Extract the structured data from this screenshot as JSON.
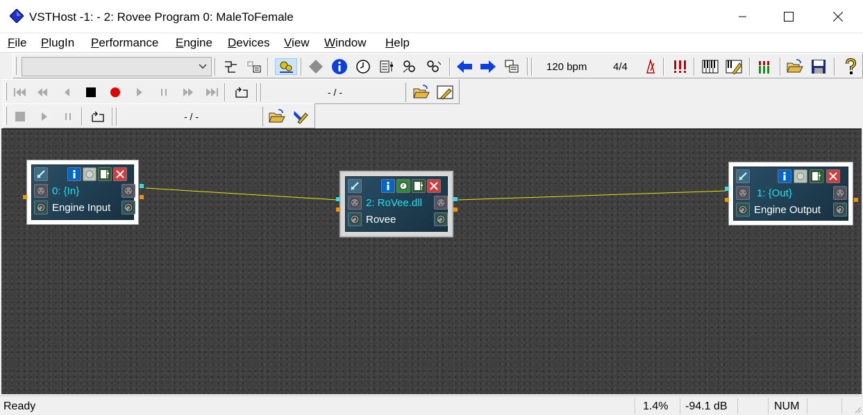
{
  "window": {
    "title": "VSTHost -1:  - 2: Rovee Program 0: MaleToFemale",
    "controls": [
      "minimize-icon",
      "maximize-icon",
      "close-icon"
    ]
  },
  "menu": {
    "items": [
      {
        "label_ul": "F",
        "label_rest": "ile"
      },
      {
        "label_ul": "P",
        "label_rest": "lugIn"
      },
      {
        "label_ul": "P",
        "label_rest": "erformance"
      },
      {
        "label_ul": "E",
        "label_rest": "ngine"
      },
      {
        "label_ul": "D",
        "label_rest": "evices"
      },
      {
        "label_ul": "V",
        "label_rest": "iew"
      },
      {
        "label_ul": "W",
        "label_rest": "indow"
      },
      {
        "label_ul": "H",
        "label_rest": "elp"
      }
    ]
  },
  "toolbar": {
    "plugin_combo_value": "",
    "bpm": "120 bpm",
    "time_signature": "4/4",
    "icons_row1": [
      "chain-plugin-icon",
      "chain-list-icon",
      "engine-bypass-icon",
      "diamond-icon",
      "info-icon",
      "clock-icon",
      "parameters-icon",
      "midi-link-icon",
      "midi-link-2-icon",
      "arrow-left-icon",
      "arrow-right-icon",
      "windows-icon",
      "metronome-icon",
      "alert-icon",
      "keyboard-icon",
      "keyboard-config-icon",
      "vu-meter-icon",
      "open-folder-icon",
      "save-icon",
      "help-icon"
    ]
  },
  "player": {
    "position": "- / -",
    "icons": [
      "to-start-icon",
      "rewind-icon",
      "back-icon",
      "stop-icon",
      "record-icon",
      "play-icon",
      "pause-icon",
      "forward-icon",
      "to-end-icon",
      "loop-icon",
      "open-folder-icon",
      "configure-icon"
    ]
  },
  "recorder": {
    "position": "- / -",
    "icons": [
      "stop-icon",
      "play-icon",
      "pause-icon",
      "loop-icon",
      "open-folder-icon",
      "configure-icon"
    ]
  },
  "nodes": [
    {
      "id": "in",
      "title": "0: {In}",
      "subtitle": "Engine Input"
    },
    {
      "id": "rovee",
      "title": "2: RoVee.dll",
      "subtitle": "Rovee"
    },
    {
      "id": "out",
      "title": "1: {Out}",
      "subtitle": "Engine Output"
    }
  ],
  "colors": {
    "wire": "#e8e800",
    "node_title": "#19e3ef",
    "canvas": "#3f3f3f"
  },
  "status": {
    "text": "Ready",
    "cpu": "1.4%",
    "level": "-94.1 dB",
    "num": "NUM"
  }
}
